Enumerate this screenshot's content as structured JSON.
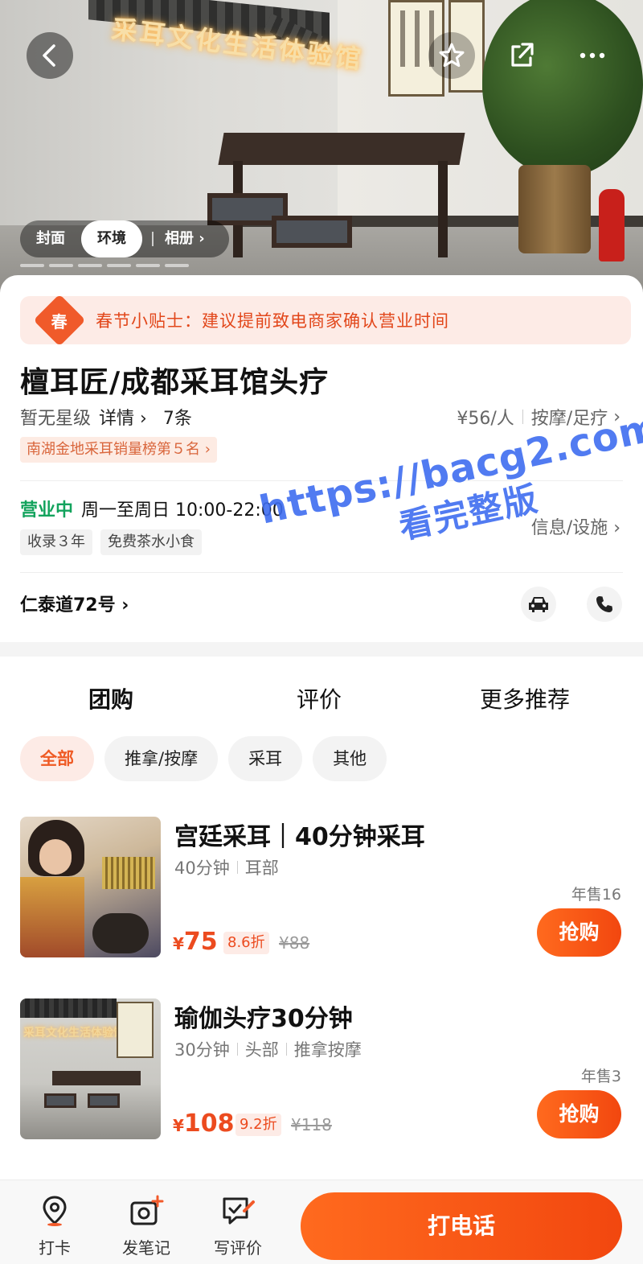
{
  "hero": {
    "sign_text": "采耳文化生活体验馆",
    "album_tabs": [
      "封面",
      "环境",
      "相册"
    ],
    "active_album_tab": "环境"
  },
  "notice": {
    "badge": "春",
    "text": "春节小贴士：建议提前致电商家确认营业时间"
  },
  "shop": {
    "name": "檀耳匠/成都采耳馆头疗",
    "rating": "暂无星级",
    "detail_link": "详情",
    "review_count": "7条",
    "price_per_person": "¥56/人",
    "category": "按摩/足疗",
    "rank_tag": "南湖金地采耳销量榜第５名",
    "status": "营业中",
    "hours": "周一至周日 10:00-22:00",
    "tags": [
      "收录３年",
      "免费茶水小食"
    ],
    "facility_link": "信息/设施",
    "address": "仁泰道72号"
  },
  "main_tabs": [
    "团购",
    "评价",
    "更多推荐"
  ],
  "active_main_tab": "团购",
  "filters": [
    "全部",
    "推拿/按摩",
    "采耳",
    "其他"
  ],
  "active_filter": "全部",
  "deals": [
    {
      "title": "宫廷采耳｜40分钟采耳",
      "meta": [
        "40分钟",
        "耳部"
      ],
      "sold": "年售16",
      "currency": "¥",
      "price": "75",
      "discount": "8.6折",
      "original_price": "¥88",
      "buy_label": "抢购"
    },
    {
      "title": "瑜伽头疗30分钟",
      "meta": [
        "30分钟",
        "头部",
        "推拿按摩"
      ],
      "sold": "年售3",
      "currency": "¥",
      "price": "108",
      "discount": "9.2折",
      "original_price": "¥118",
      "buy_label": "抢购"
    }
  ],
  "bottom_bar": {
    "checkin": "打卡",
    "post_note": "发笔记",
    "write_review": "写评价",
    "call": "打电话"
  },
  "watermark": {
    "line1": "https://bacg2.com",
    "line2": "看完整版"
  },
  "colors": {
    "accent": "#f2470f",
    "open_green": "#13a35d",
    "watermark": "#3f6df0"
  }
}
